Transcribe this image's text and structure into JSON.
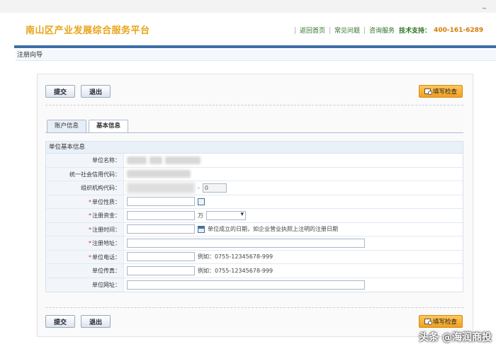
{
  "window": {
    "minimize": "_"
  },
  "header": {
    "site_title": "南山区产业发展综合服务平台",
    "links": [
      "返回首页",
      "常见问题",
      "咨询服务"
    ],
    "support_label": "技术支持：",
    "support_phone": "400-161-6289"
  },
  "breadcrumb": "注册向导",
  "buttons": {
    "submit": "提交",
    "exit": "退出",
    "check": "填写检查"
  },
  "tabs": [
    {
      "label": "账户信息",
      "active": false
    },
    {
      "label": "基本信息",
      "active": true
    }
  ],
  "form": {
    "section_title": "单位基本信息",
    "rows": {
      "name": {
        "label": "单位名称："
      },
      "credit_code": {
        "label": "统一社会信用代码："
      },
      "org_code": {
        "label": "组织机构代码：",
        "suffix_sep": "-",
        "suffix_value": "0"
      },
      "nature": {
        "label": "单位性质：",
        "required": "*"
      },
      "capital": {
        "label": "注册资金：",
        "required": "*",
        "unit": "万"
      },
      "reg_date": {
        "label": "注册时间：",
        "required": "*",
        "hint": "单位成立的日期，如企业营业执照上注明的注册日期"
      },
      "reg_address": {
        "label": "注册地址：",
        "required": "*"
      },
      "phone": {
        "label": "单位电话：",
        "required": "*",
        "hint": "例如：0755-12345678-999"
      },
      "fax": {
        "label": "单位传真：",
        "hint": "例如：0755-12345678-999"
      },
      "website": {
        "label": "单位网址："
      }
    }
  },
  "watermark": "头条 @海润商投"
}
